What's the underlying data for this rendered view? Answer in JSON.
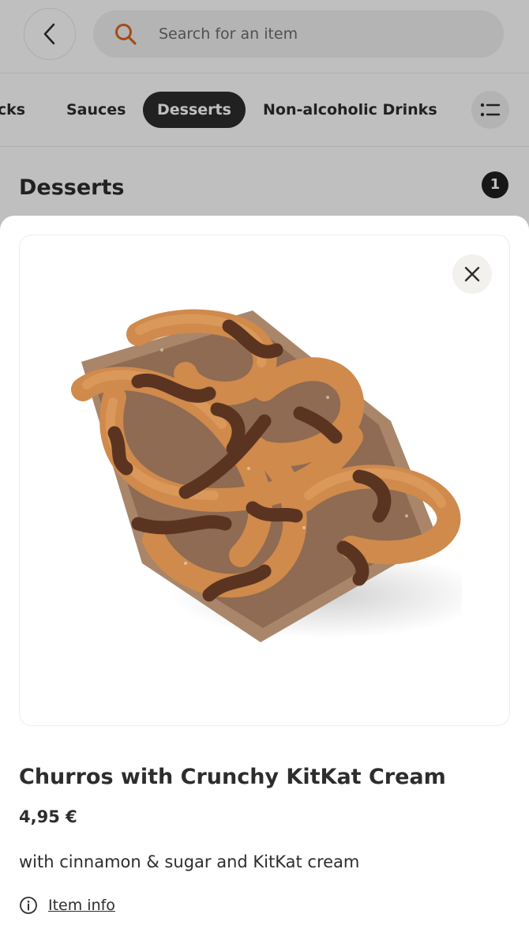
{
  "search": {
    "placeholder": "Search for an item"
  },
  "categories": [
    {
      "label": "Snacks",
      "visible_text": "acks"
    },
    {
      "label": "Sauces"
    },
    {
      "label": "Desserts",
      "active": true
    },
    {
      "label": "Non-alcoholic Drinks"
    }
  ],
  "section": {
    "title": "Desserts",
    "count": "1"
  },
  "product": {
    "title": "Churros with Crunchy KitKat Cream",
    "price": "4,95 €",
    "description": "with cinnamon & sugar and KitKat cream",
    "info_link": "Item info"
  },
  "icons": {
    "back": "chevron-left-icon",
    "search": "search-icon",
    "filter": "list-icon",
    "close": "close-icon",
    "info": "info-icon"
  },
  "colors": {
    "search_accent": "#d9661f",
    "active_chip": "#2d2d2d",
    "text": "#2d2d2d"
  }
}
